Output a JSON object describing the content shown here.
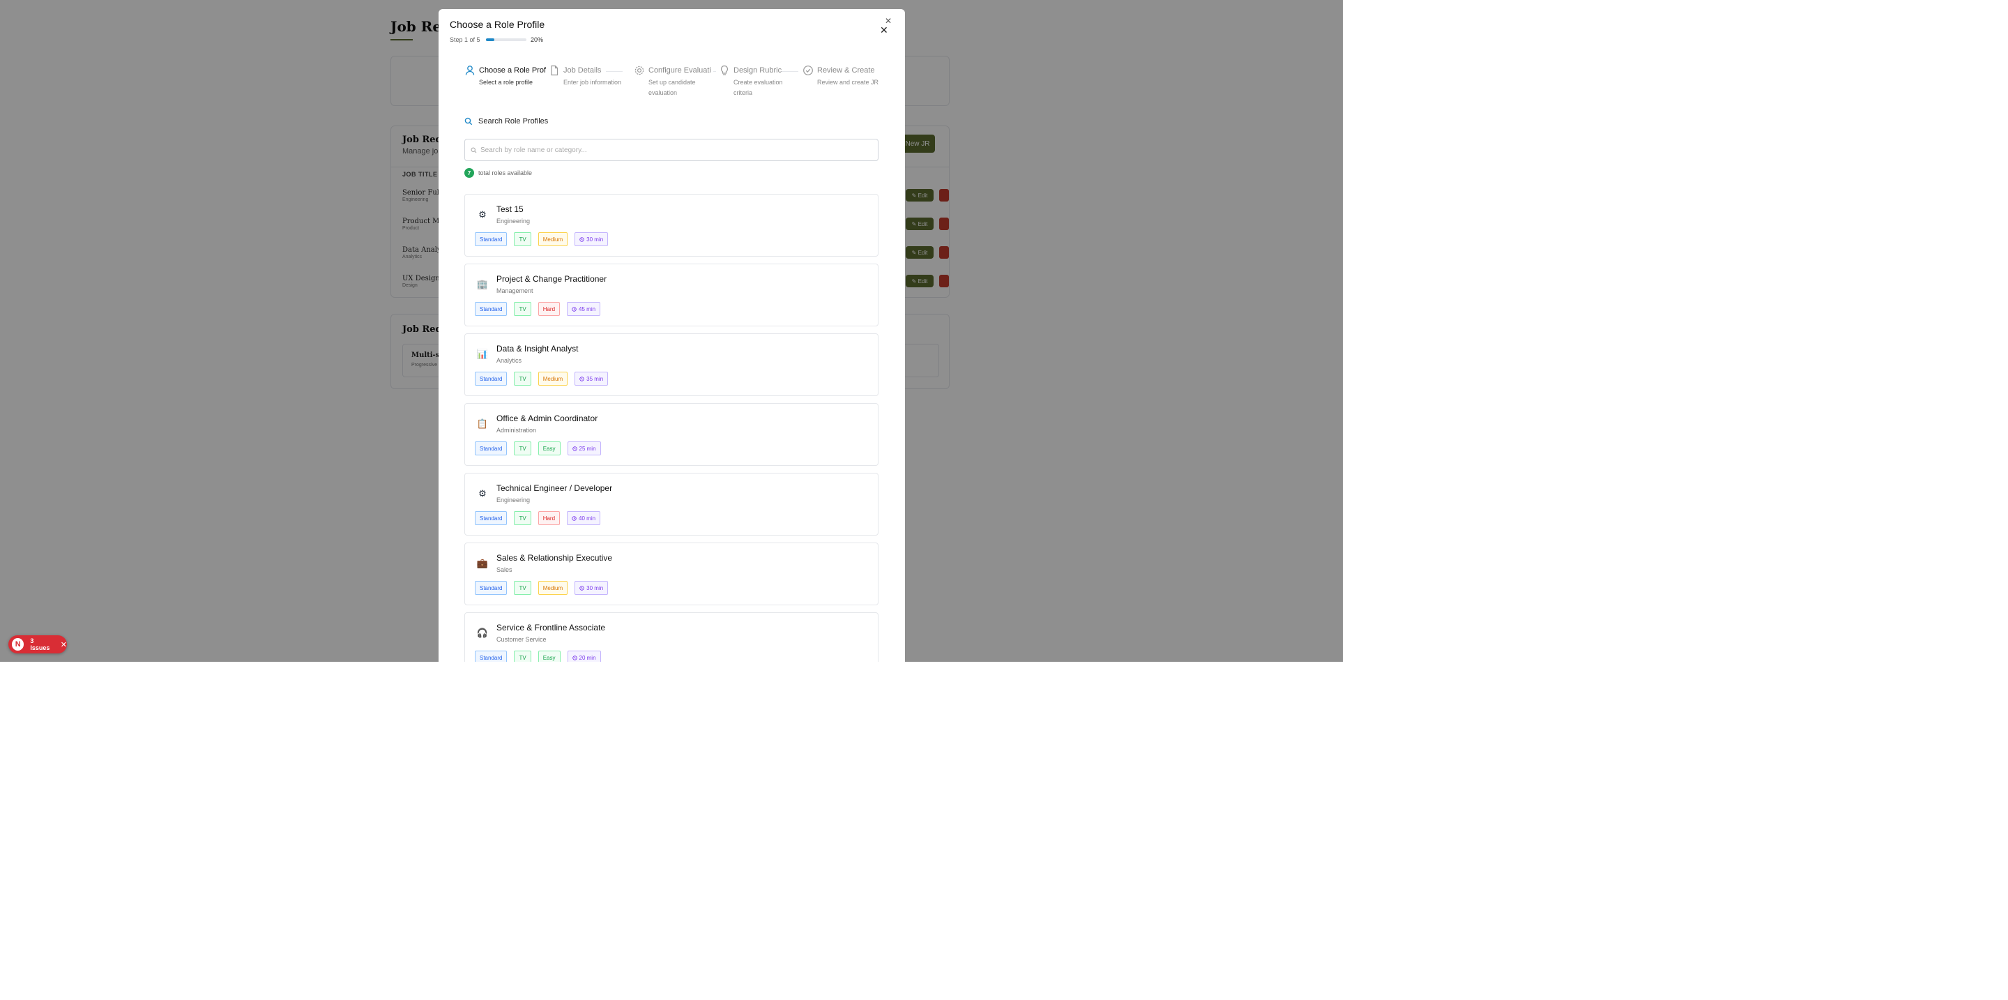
{
  "background": {
    "page_title": "Job Requ",
    "filter_card": {},
    "list": {
      "title": "Job Requi",
      "subtitle": "Manage job o",
      "new_button": "New JR",
      "col_header": "JOB TITLE",
      "rows": [
        {
          "title": "Senior Full St",
          "dept": "Engineering",
          "edit": "Edit"
        },
        {
          "title": "Product Mana",
          "dept": "Product",
          "edit": "Edit"
        },
        {
          "title": "Data Analyst",
          "dept": "Analytics",
          "edit": "Edit"
        },
        {
          "title": "UX Designer",
          "dept": "Design",
          "edit": "Edit"
        }
      ]
    },
    "section2": {
      "title": "Job Requ",
      "item_title": "Multi-step",
      "item_sub": "Progressive"
    }
  },
  "issues_badge": {
    "letter": "N",
    "text": "3 Issues",
    "close": "✕"
  },
  "modal": {
    "title": "Choose a Role Profile",
    "close_top": "✕",
    "close": "✕",
    "step_text": "Step 1 of 5",
    "progress": 0.2,
    "progress_label": "20%",
    "steps": [
      {
        "label": "Choose a Role Prof",
        "sub": "Select a role profile",
        "icon": "user-icon",
        "active": true
      },
      {
        "label": "Job Details",
        "sub": "Enter job information",
        "icon": "document-icon",
        "active": false
      },
      {
        "label": "Configure Evaluati",
        "sub": "Set up candidate evaluation",
        "icon": "gear-icon",
        "active": false
      },
      {
        "label": "Design Rubric",
        "sub": "Create evaluation criteria",
        "icon": "lightbulb-icon",
        "active": false
      },
      {
        "label": "Review & Create",
        "sub": "Review and create JR",
        "icon": "check-circle-icon",
        "active": false
      }
    ],
    "search": {
      "heading": "Search Role Profiles",
      "placeholder": "Search by role name or category..."
    },
    "count": {
      "number": "7",
      "text": "total roles available"
    },
    "roles": [
      {
        "name": "Test 15",
        "category": "Engineering",
        "icon": "gear-icon",
        "glyph": "⚙",
        "tags": [
          "Standard",
          "TV",
          "Medium",
          "30 min"
        ],
        "difficulty": "medium"
      },
      {
        "name": "Project & Change Practitioner",
        "category": "Management",
        "icon": "building-icon",
        "glyph": "🏢",
        "tags": [
          "Standard",
          "TV",
          "Hard",
          "45 min"
        ],
        "difficulty": "hard"
      },
      {
        "name": "Data & Insight Analyst",
        "category": "Analytics",
        "icon": "bar-chart-icon",
        "glyph": "📊",
        "tags": [
          "Standard",
          "TV",
          "Medium",
          "35 min"
        ],
        "difficulty": "medium"
      },
      {
        "name": "Office & Admin Coordinator",
        "category": "Administration",
        "icon": "clipboard-icon",
        "glyph": "📋",
        "tags": [
          "Standard",
          "TV",
          "Easy",
          "25 min"
        ],
        "difficulty": "easy"
      },
      {
        "name": "Technical Engineer / Developer",
        "category": "Engineering",
        "icon": "gear-icon",
        "glyph": "⚙",
        "tags": [
          "Standard",
          "TV",
          "Hard",
          "40 min"
        ],
        "difficulty": "hard"
      },
      {
        "name": "Sales & Relationship Executive",
        "category": "Sales",
        "icon": "briefcase-icon",
        "glyph": "💼",
        "tags": [
          "Standard",
          "TV",
          "Medium",
          "30 min"
        ],
        "difficulty": "medium"
      },
      {
        "name": "Service & Frontline Associate",
        "category": "Customer Service",
        "icon": "headphones-icon",
        "glyph": "🎧",
        "tags": [
          "Standard",
          "TV",
          "Easy",
          "20 min"
        ],
        "difficulty": "easy"
      }
    ]
  },
  "colors": {
    "accent": "#1e88c7",
    "olive": "#5b6b2f",
    "danger": "#d92d35"
  }
}
